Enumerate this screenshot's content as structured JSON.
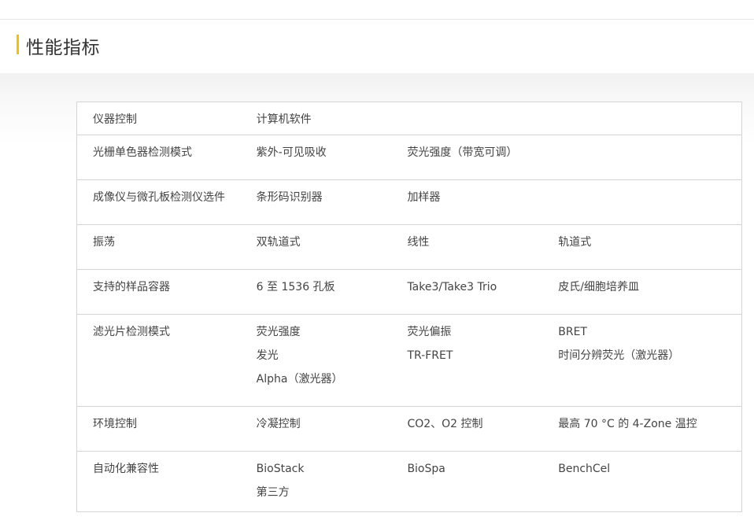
{
  "section": {
    "title": "性能指标"
  },
  "rows": [
    {
      "label": "仪器控制",
      "cols": [
        [
          "计算机软件"
        ],
        [],
        []
      ]
    },
    {
      "label": "光栅单色器检测模式",
      "cols": [
        [
          "紫外-可见吸收"
        ],
        [
          "荧光强度（带宽可调）"
        ],
        []
      ]
    },
    {
      "label": "成像仪与微孔板检测仪选件",
      "cols": [
        [
          "条形码识别器"
        ],
        [
          "加样器"
        ],
        []
      ]
    },
    {
      "label": "振荡",
      "cols": [
        [
          "双轨道式"
        ],
        [
          "线性"
        ],
        [
          "轨道式"
        ]
      ]
    },
    {
      "label": "支持的样品容器",
      "cols": [
        [
          "6 至 1536 孔板"
        ],
        [
          "Take3/Take3 Trio"
        ],
        [
          "皮氏/细胞培养皿"
        ]
      ]
    },
    {
      "label": "滤光片检测模式",
      "cols": [
        [
          "荧光强度",
          "发光",
          "Alpha（激光器）"
        ],
        [
          "荧光偏振",
          "TR-FRET"
        ],
        [
          "BRET",
          "时间分辨荧光（激光器）"
        ]
      ]
    },
    {
      "label": "环境控制",
      "cols": [
        [
          "冷凝控制"
        ],
        [
          "CO2、O2 控制"
        ],
        [
          "最高 70 °C 的 4-Zone 温控"
        ]
      ]
    },
    {
      "label": "自动化兼容性",
      "cols": [
        [
          "BioStack",
          "第三方"
        ],
        [
          "BioSpa"
        ],
        [
          "BenchCel"
        ]
      ]
    }
  ]
}
